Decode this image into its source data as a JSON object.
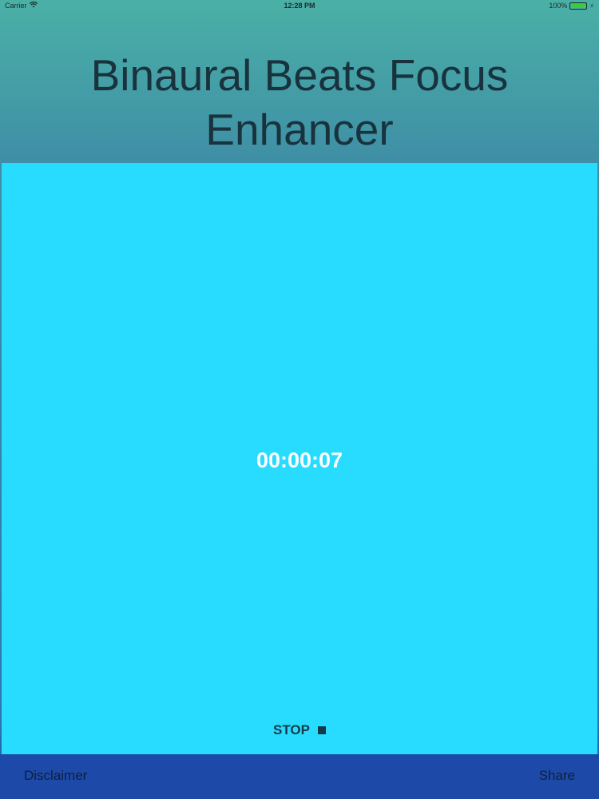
{
  "status_bar": {
    "carrier": "Carrier",
    "time": "12:28 PM",
    "battery": "100%",
    "battery_level": 1.0
  },
  "header": {
    "title": "Binaural Beats Focus Enhancer"
  },
  "main": {
    "timer": "00:00:07",
    "stop_label": "STOP"
  },
  "footer": {
    "disclaimer_label": "Disclaimer",
    "share_label": "Share"
  },
  "colors": {
    "panel": "#28dcff",
    "footer": "#1d4aa8",
    "timer_text": "#ffffff",
    "title_text": "#18333d"
  }
}
